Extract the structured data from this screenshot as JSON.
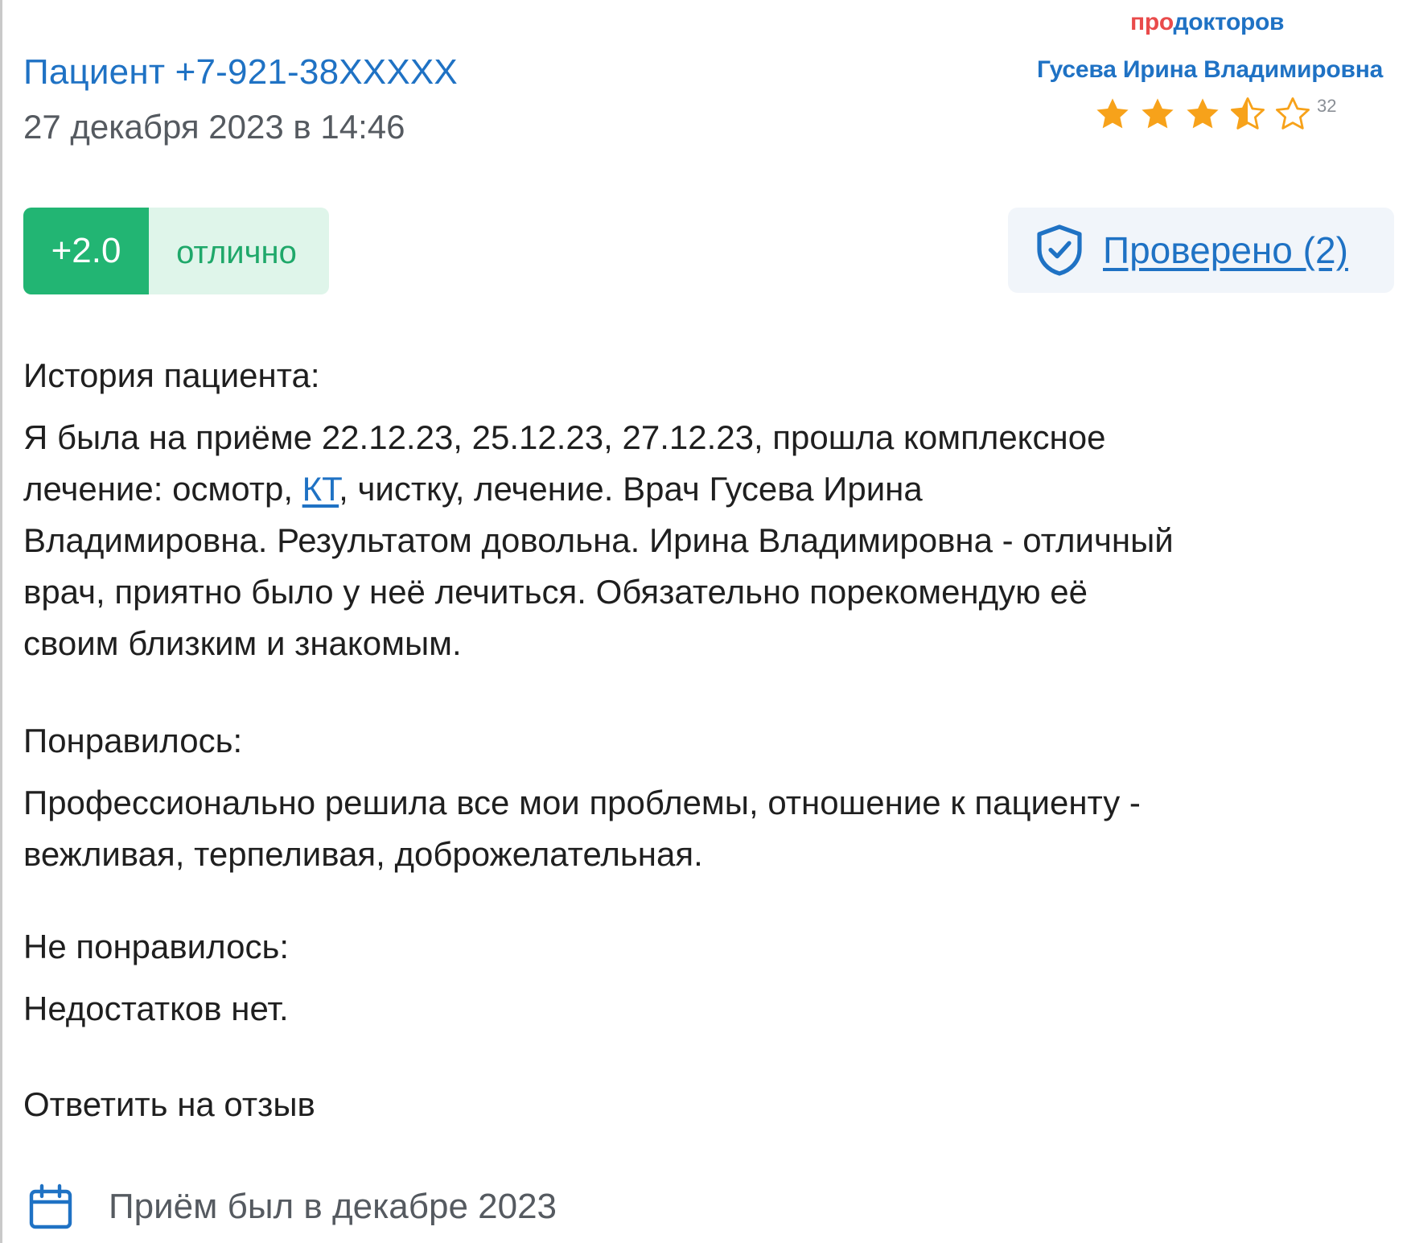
{
  "review": {
    "patient_title": "Пациент +7-921-38XXXXX",
    "date": "27 декабря 2023 в 14:46",
    "score_value": "+2.0",
    "score_label": "отлично",
    "verified_label": "Проверено (2)",
    "reply_label": "Ответить на отзыв",
    "visit_info": "Приём был в декабре 2023"
  },
  "widget": {
    "brand_part1": "про",
    "brand_part2": "докторов",
    "doctor_name": "Гусева Ирина Владимировна",
    "rating_stars": 3.5,
    "rating_max": 5,
    "rating_count": "32"
  },
  "sections": {
    "history": {
      "heading": "История пациента:",
      "line1": "Я была на приёме 22.12.23, 25.12.23, 27.12.23, прошла комплексное",
      "line2_before": "лечение: осмотр, ",
      "line2_link": "КТ",
      "line2_after": ", чистку, лечение. Врач Гусева Ирина",
      "line3": "Владимировна. Результатом довольна. Ирина Владимировна - отличный",
      "line4": "врач, приятно было у неё лечиться. Обязательно порекомендую её",
      "line5": "своим близким и знакомым."
    },
    "liked": {
      "heading": "Понравилось:",
      "line1": "Профессионально решила все мои проблемы, отношение к пациенту -",
      "line2": "вежливая, терпеливая, доброжелательная."
    },
    "disliked": {
      "heading": "Не понравилось:",
      "line1": "Недостатков нет."
    }
  },
  "colors": {
    "link_blue": "#1f72c4",
    "score_green": "#22b573",
    "score_bg": "#dff5ea",
    "star_orange": "#f7a21a",
    "brand_red": "#e94b4b",
    "verified_bg": "#f1f5fa"
  },
  "icons": {
    "stars": "star-icon",
    "verified": "shield-check-icon",
    "visit": "calendar-icon"
  }
}
